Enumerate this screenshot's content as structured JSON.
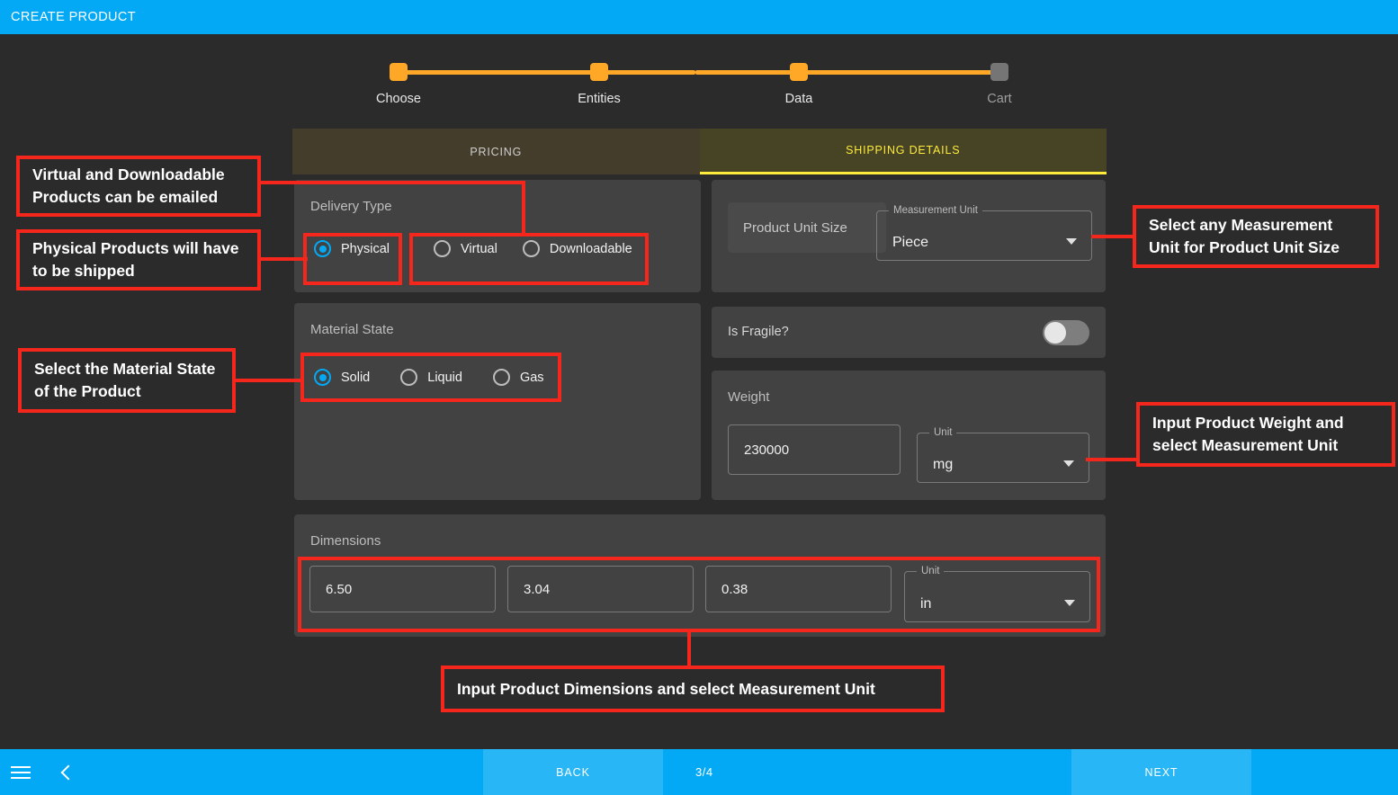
{
  "appbar": {
    "title": "CREATE PRODUCT"
  },
  "stepper": {
    "steps": [
      {
        "label": "Choose",
        "state": "done"
      },
      {
        "label": "Entities",
        "state": "done"
      },
      {
        "label": "Data",
        "state": "active"
      },
      {
        "label": "Cart",
        "state": "inactive"
      }
    ]
  },
  "tabs": [
    {
      "label": "PRICING",
      "active": false
    },
    {
      "label": "SHIPPING DETAILS",
      "active": true
    }
  ],
  "delivery": {
    "title": "Delivery Type",
    "options": [
      {
        "label": "Physical",
        "selected": true
      },
      {
        "label": "Virtual",
        "selected": false
      },
      {
        "label": "Downloadable",
        "selected": false
      }
    ]
  },
  "unit_size": {
    "input_placeholder": "Product Unit Size",
    "input_value": "",
    "select_label": "Measurement Unit",
    "select_value": "Piece"
  },
  "material": {
    "title": "Material State",
    "options": [
      {
        "label": "Solid",
        "selected": true
      },
      {
        "label": "Liquid",
        "selected": false
      },
      {
        "label": "Gas",
        "selected": false
      }
    ]
  },
  "fragile": {
    "label": "Is Fragile?",
    "on": false
  },
  "weight": {
    "title": "Weight",
    "value": "230000",
    "unit_label": "Unit",
    "unit_value": "mg"
  },
  "dimensions": {
    "title": "Dimensions",
    "length": "6.50",
    "width": "3.04",
    "height": "0.38",
    "unit_label": "Unit",
    "unit_value": "in"
  },
  "annotations": [
    {
      "text": "Virtual and Downloadable Products can be emailed"
    },
    {
      "text": "Physical Products will have to be shipped"
    },
    {
      "text": "Select the Material State of the Product"
    },
    {
      "text": "Select any Measurement Unit for Product Unit Size"
    },
    {
      "text": "Input Product Weight and select Measurement Unit"
    },
    {
      "text": "Input Product Dimensions and select Measurement Unit"
    }
  ],
  "bottombar": {
    "menu_icon": "hamburger-icon",
    "back_icon": "chevron-left-icon",
    "back_label": "BACK",
    "page_indicator": "3/4",
    "next_label": "NEXT"
  },
  "colors": {
    "accent_blue": "#03A9F4",
    "step_orange": "#FFA726",
    "tab_active_yellow": "#ffeb3b",
    "annotation_red": "#F5261C",
    "page_bg": "#2b2b2b",
    "panel_bg": "#424242"
  }
}
